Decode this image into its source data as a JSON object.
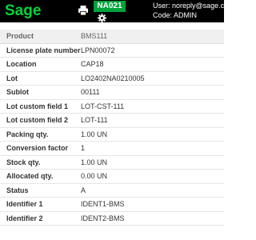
{
  "header": {
    "logo": "Sage",
    "site_badge": "NA021",
    "user_line": "User: noreply@sage.com",
    "code_line": "Code: ADMIN",
    "icons": [
      "printer-icon",
      "gear-icon"
    ],
    "colors": {
      "bar": "#000000",
      "logo": "#00d639",
      "badge": "#00a33a"
    }
  },
  "details": {
    "rows": [
      {
        "label": "Product",
        "value": "BMS111"
      },
      {
        "label": "License plate number",
        "value": "LPN00072"
      },
      {
        "label": "Location",
        "value": "CAP18"
      },
      {
        "label": "Lot",
        "value": "LO2402NA0210005"
      },
      {
        "label": "Sublot",
        "value": "00111"
      },
      {
        "label": "Lot custom field 1",
        "value": "LOT-CST-111"
      },
      {
        "label": "Lot custom field 2",
        "value": "LOT-111"
      },
      {
        "label": "Packing qty.",
        "value": "1.00 UN"
      },
      {
        "label": "Conversion factor",
        "value": "1"
      },
      {
        "label": "Stock qty.",
        "value": "1.00 UN"
      },
      {
        "label": "Allocated qty.",
        "value": "0.00 UN"
      },
      {
        "label": "Status",
        "value": "A"
      },
      {
        "label": "Identifier 1",
        "value": "IDENT1-BMS"
      },
      {
        "label": "Identifier 2",
        "value": "IDENT2-BMS"
      }
    ]
  }
}
